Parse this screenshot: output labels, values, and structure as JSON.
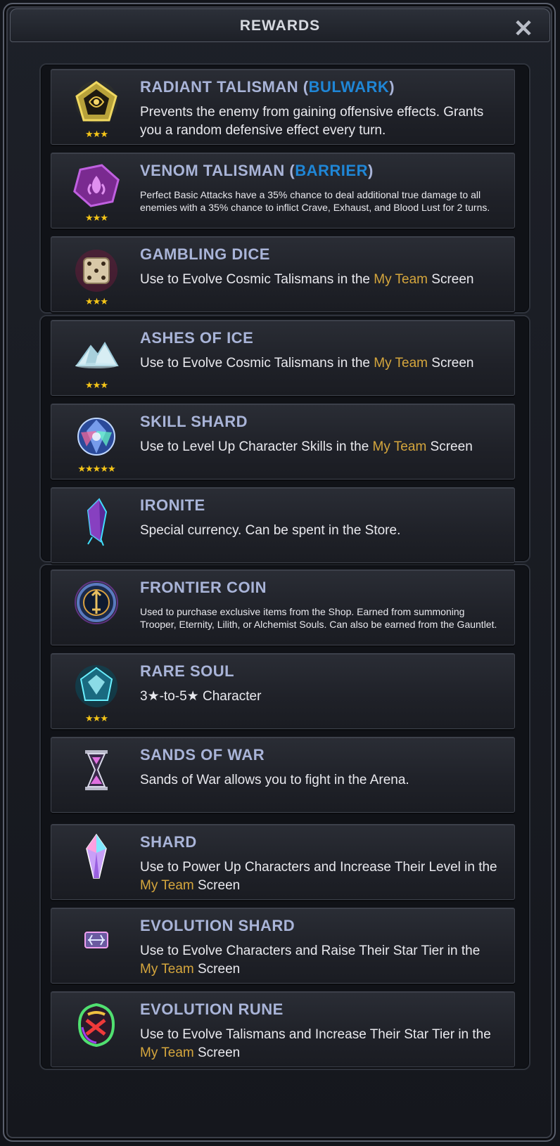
{
  "window": {
    "title": "REWARDS",
    "close_label": "✕"
  },
  "rewards": [
    {
      "id": "radiant",
      "name": "RADIANT TALISMAN (",
      "name_hl": "BULWARK",
      "name_end": ")",
      "stars": "★★★",
      "desc": "Prevents the enemy from gaining offensive effects. Grants you a random defensive effect every turn.",
      "small": false
    },
    {
      "id": "venom",
      "name": "VENOM TALISMAN (",
      "name_hl": "BARRIER",
      "name_end": ")",
      "stars": "★★★",
      "desc": "Perfect Basic Attacks have a 35% chance to deal additional true damage to all enemies with a 35% chance to inflict Crave, Exhaust, and  Blood Lust for 2 turns.",
      "small": true
    },
    {
      "id": "dice",
      "name": "GAMBLING DICE",
      "stars": "★★★",
      "desc_pre": "Use to Evolve Cosmic Talismans in the ",
      "desc_gold": "My Team",
      "desc_post": " Screen"
    },
    {
      "id": "ashes",
      "name": "ASHES OF ICE",
      "stars": "★★★",
      "desc_pre": "Use to Evolve Cosmic Talismans in the ",
      "desc_gold": "My Team",
      "desc_post": " Screen"
    },
    {
      "id": "skill",
      "name": "SKILL SHARD",
      "stars": "★★★★★",
      "desc_pre": "Use to Level Up Character Skills in the ",
      "desc_gold": "My Team",
      "desc_post": " Screen"
    },
    {
      "id": "ironite",
      "name": "IRONITE",
      "stars": "",
      "desc": "Special currency. Can be spent in the Store."
    },
    {
      "id": "frontier",
      "name": "FRONTIER COIN",
      "stars": "",
      "desc": "Used to purchase exclusive items from the Shop. Earned from summoning Trooper, Eternity, Lilith, or Alchemist Souls. Can also be earned from the Gauntlet.",
      "small": true
    },
    {
      "id": "rare",
      "name": "RARE SOUL",
      "stars": "★★★",
      "desc": "3★-to-5★ Character"
    },
    {
      "id": "sands",
      "name": "SANDS OF WAR",
      "stars": "",
      "desc": "Sands of War allows you to fight in the Arena."
    },
    {
      "id": "shard",
      "name": "SHARD",
      "stars": "",
      "desc_pre": "Use to Power Up Characters and Increase Their Level in the ",
      "desc_gold": "My Team",
      "desc_post": " Screen"
    },
    {
      "id": "evoshard",
      "name": "EVOLUTION SHARD",
      "stars": "",
      "desc_pre": "Use to Evolve Characters and Raise Their Star Tier in the ",
      "desc_gold": "My Team",
      "desc_post": " Screen"
    },
    {
      "id": "evorune",
      "name": "EVOLUTION RUNE",
      "stars": "",
      "desc_pre": "Use to Evolve Talismans and Increase Their Star Tier in the ",
      "desc_gold": "My Team",
      "desc_post": " Screen"
    }
  ]
}
